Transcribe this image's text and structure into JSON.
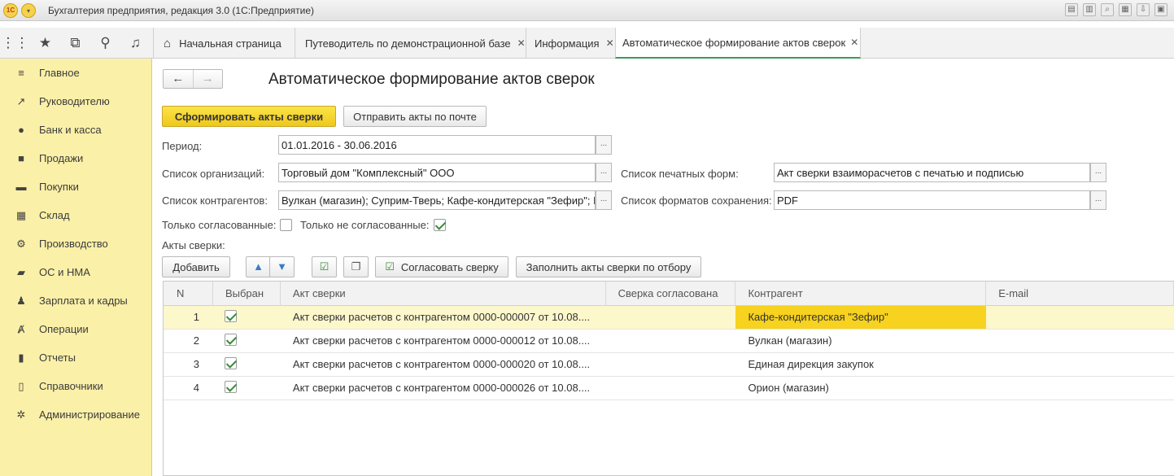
{
  "window": {
    "title": "Бухгалтерия предприятия, редакция 3.0 (1С:Предприятие)",
    "logo_text": "1С"
  },
  "tabs": [
    {
      "label": "Начальная страница",
      "closable": false,
      "active": false
    },
    {
      "label": "Путеводитель по демонстрационной базе",
      "closable": true,
      "active": false
    },
    {
      "label": "Информация",
      "closable": true,
      "active": false
    },
    {
      "label": "Автоматическое формирование актов сверок",
      "closable": true,
      "active": true
    }
  ],
  "close_glyph": "✕",
  "sidebar": {
    "items": [
      {
        "label": "Главное",
        "icon": "menu-icon"
      },
      {
        "label": "Руководителю",
        "icon": "trend-icon"
      },
      {
        "label": "Банк и касса",
        "icon": "coin-icon"
      },
      {
        "label": "Продажи",
        "icon": "bag-icon"
      },
      {
        "label": "Покупки",
        "icon": "cart-icon"
      },
      {
        "label": "Склад",
        "icon": "warehouse-icon"
      },
      {
        "label": "Производство",
        "icon": "factory-icon"
      },
      {
        "label": "ОС и НМА",
        "icon": "truck-icon"
      },
      {
        "label": "Зарплата и кадры",
        "icon": "person-icon"
      },
      {
        "label": "Операции",
        "icon": "operations-icon"
      },
      {
        "label": "Отчеты",
        "icon": "bar-chart-icon"
      },
      {
        "label": "Справочники",
        "icon": "book-icon"
      },
      {
        "label": "Администрирование",
        "icon": "gear-icon"
      }
    ]
  },
  "page": {
    "title": "Автоматическое формирование актов сверок",
    "btn_generate": "Сформировать акты сверки",
    "btn_send": "Отправить акты по почте",
    "period_label": "Период:",
    "period_value": "01.01.2016 - 30.06.2016",
    "orgs_label": "Список организаций:",
    "orgs_value": "Торговый дом \"Комплексный\" ООО",
    "contractors_label": "Список контрагентов:",
    "contractors_value": "Вулкан (магазин); Суприм-Тверь; Кафе-кондитерская \"Зефир\"; Е",
    "print_forms_label": "Список печатных форм:",
    "print_forms_value": "Акт сверки взаиморасчетов с печатью и подписью",
    "save_formats_label": "Список форматов сохранения:",
    "save_formats_value": "PDF",
    "only_agreed_label": "Только согласованные:",
    "only_agreed": false,
    "only_not_agreed_label": "Только не согласованные:",
    "only_not_agreed": true,
    "acts_label": "Акты сверки:",
    "btn_add": "Добавить",
    "btn_agree": "Согласовать сверку",
    "btn_fill": "Заполнить акты сверки по отбору",
    "pick_glyph": "..."
  },
  "table": {
    "columns": [
      "N",
      "Выбран",
      "Акт сверки",
      "Сверка согласована",
      "Контрагент",
      "E-mail"
    ],
    "rows": [
      {
        "n": "1",
        "selected": true,
        "act": "Акт сверки расчетов с контрагентом 0000-000007 от 10.08....",
        "agreed": "",
        "contractor": "Кафе-кондитерская \"Зефир\"",
        "email": ""
      },
      {
        "n": "2",
        "selected": true,
        "act": "Акт сверки расчетов с контрагентом 0000-000012 от 10.08....",
        "agreed": "",
        "contractor": "Вулкан (магазин)",
        "email": ""
      },
      {
        "n": "3",
        "selected": true,
        "act": "Акт сверки расчетов с контрагентом 0000-000020 от 10.08....",
        "agreed": "",
        "contractor": "Единая дирекция закупок",
        "email": ""
      },
      {
        "n": "4",
        "selected": true,
        "act": "Акт сверки расчетов с контрагентом 0000-000026 от 10.08....",
        "agreed": "",
        "contractor": "Орион (магазин)",
        "email": ""
      }
    ]
  }
}
